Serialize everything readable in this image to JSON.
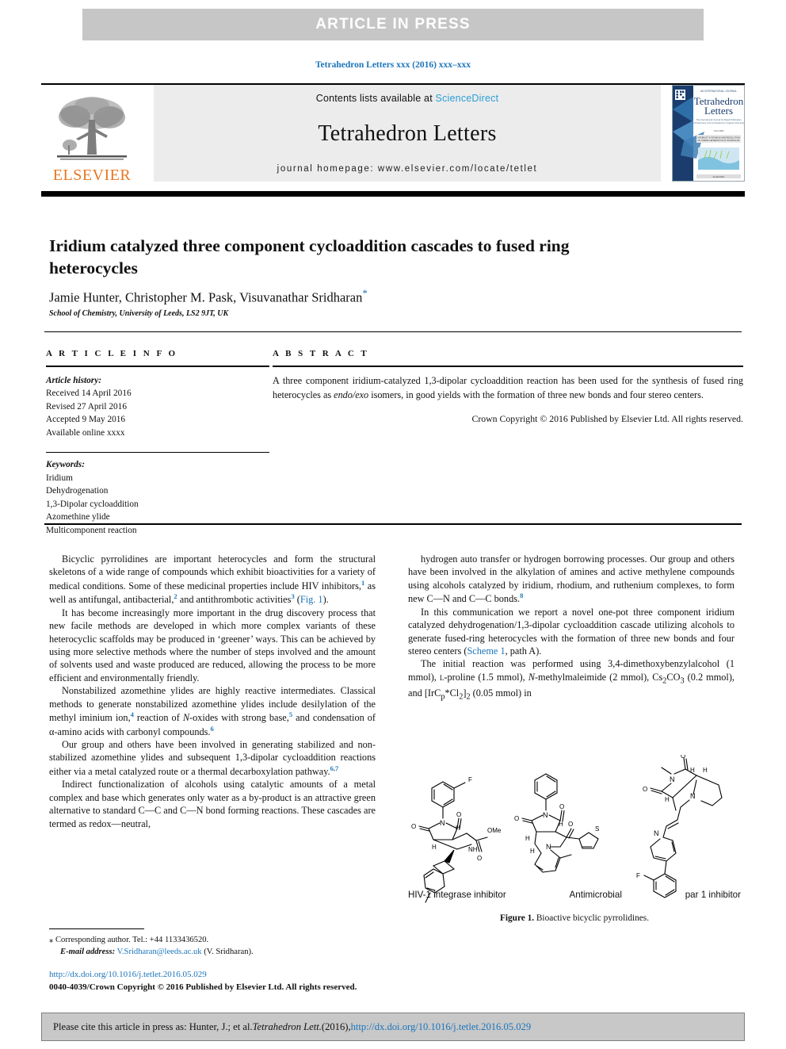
{
  "banner": {
    "text": "ARTICLE  IN  PRESS",
    "bg": "#c6c6c6",
    "fg": "#ffffff"
  },
  "journal_ref": "Tetrahedron Letters xxx (2016) xxx–xxx",
  "masthead": {
    "contents_prefix": "Contents lists available at ",
    "sciencedirect": "ScienceDirect",
    "journal_title": "Tetrahedron Letters",
    "homepage": "journal homepage: www.elsevier.com/locate/tetlet",
    "publisher": "ELSEVIER",
    "cover_title_line1": "Tetrahedron",
    "cover_title_line2": "Letters",
    "link_color": "#2a9fd6"
  },
  "article": {
    "title": "Iridium catalyzed three component cycloaddition cascades to fused ring heterocycles",
    "authors": "Jamie Hunter, Christopher M. Pask, Visuvanathar Sridharan",
    "corresponding_marker": "*",
    "affiliation": "School of Chemistry, University of Leeds, LS2 9JT, UK"
  },
  "info": {
    "heading": "A R T I C L E   I N F O",
    "history_label": "Article history:",
    "history": [
      "Received 14 April 2016",
      "Revised 27 April 2016",
      "Accepted 9 May 2016",
      "Available online xxxx"
    ],
    "keywords_label": "Keywords:",
    "keywords": [
      "Iridium",
      "Dehydrogenation",
      "1,3-Dipolar cycloaddition",
      "Azomethine ylide",
      "Multicomponent reaction"
    ]
  },
  "abstract": {
    "heading": "A B S T R A C T",
    "text_1": "A three component iridium-catalyzed 1,3-dipolar cycloaddition reaction has been used for the synthesis of fused ring heterocycles as ",
    "text_em": "endo/exo",
    "text_2": " isomers, in good yields with the formation of three new bonds and four stereo centers.",
    "copyright": "Crown Copyright © 2016 Published by Elsevier Ltd. All rights reserved."
  },
  "body": {
    "left": [
      "Bicyclic pyrrolidines are important heterocycles and form the structural skeletons of a wide range of compounds which exhibit bioactivities for a variety of medical conditions. Some of these medicinal properties include HIV inhibitors,|1| as well as antifungal, antibacterial,|2| and antithrombotic activities|3| (Fig. 1).",
      "It has become increasingly more important in the drug discovery process that new facile methods are developed in which more complex variants of these heterocyclic scaffolds may be produced in ‘greener’ ways. This can be achieved by using more selective methods where the number of steps involved and the amount of solvents used and waste produced are reduced, allowing the process to be more efficient and environmentally friendly.",
      "Nonstabilized azomethine ylides are highly reactive intermediates. Classical methods to generate nonstabilized azomethine ylides include desilylation of the methyl iminium ion,|4| reaction of N-oxides with strong base,|5| and condensation of α-amino acids with carbonyl compounds.|6|",
      "Our group and others have been involved in generating stabilized and non-stabilized azomethine ylides and subsequent 1,3-dipolar cycloaddition reactions either via a metal catalyzed route or a thermal decarboxylation pathway.|6,7|",
      "Indirect functionalization of alcohols using catalytic amounts of a metal complex and base which generates only water as a by-product is an attractive green alternative to standard C—C and C—N bond forming reactions. These cascades are termed as redox—neutral,"
    ],
    "right": [
      "hydrogen auto transfer or hydrogen borrowing processes. Our group and others have been involved in the alkylation of amines and active methylene compounds using alcohols catalyzed by iridium, rhodium, and ruthenium complexes, to form new C—N and C—C bonds.|8|",
      "In this communication we report a novel one-pot three component iridium catalyzed dehydrogenation/1,3-dipolar cycloaddition cascade utilizing alcohols to generate fused-ring heterocycles with the formation of three new bonds and four stereo centers (Scheme 1, path A).",
      "The initial reaction was performed using 3,4-dimethoxybenzylalcohol (1 mmol), L-proline (1.5 mmol), N-methylmaleimide (2 mmol), Cs2CO3 (0.2 mmol), and [IrCp*Cl2]2 (0.05 mmol) in"
    ]
  },
  "figure": {
    "labels": [
      "HIV-1 integrase inhibitor",
      "Antimicrobial",
      "par 1 inhibitor"
    ],
    "caption_label": "Figure 1.",
    "caption_text": " Bioactive bicyclic pyrrolidines."
  },
  "footnote": {
    "marker": "⁎",
    "corresponding": "Corresponding author. Tel.: +44 1133436520.",
    "email_label": "E-mail address:",
    "email": "V.Sridharan@leeds.ac.uk",
    "email_suffix": " (V. Sridharan).",
    "doi_url": "http://dx.doi.org/10.1016/j.tetlet.2016.05.029",
    "issn_line": "0040-4039/Crown Copyright © 2016 Published by Elsevier Ltd. All rights reserved."
  },
  "cite_bar": {
    "prefix": "Please cite this article in press as: Hunter, J.; et al. ",
    "journal": "Tetrahedron Lett.",
    "middle": " (2016), ",
    "link": "http://dx.doi.org/10.1016/j.tetlet.2016.05.029"
  }
}
